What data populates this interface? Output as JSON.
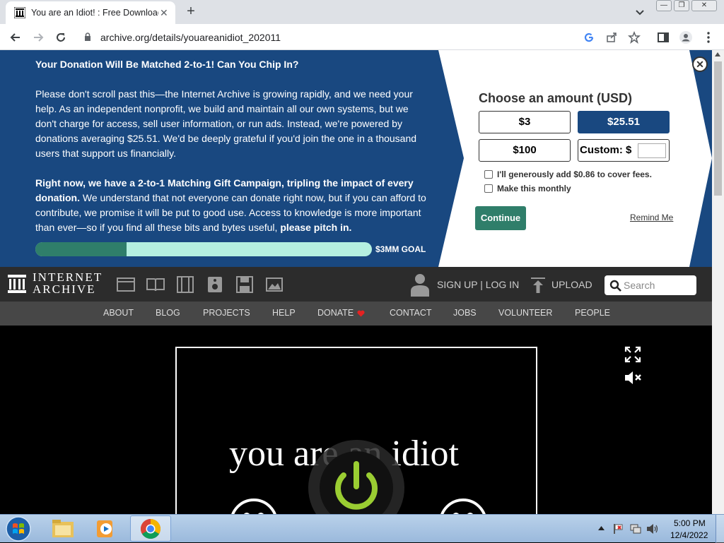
{
  "browser": {
    "tab_title": "You are an Idiot! : Free Download",
    "url": "archive.org/details/youareanidiot_202011",
    "new_tab": "+",
    "tab_close": "✕"
  },
  "banner": {
    "heading": "Your Donation Will Be Matched 2-to-1! Can You Chip In?",
    "para1": "Please don't scroll past this—the Internet Archive is growing rapidly, and we need your help. As an independent nonprofit, we build and maintain all our own systems, but we don't charge for access, sell user information, or run ads. Instead, we're powered by donations averaging $25.51. We'd be deeply grateful if you'd join the one in a thousand users that support us financially.",
    "para2_bold": "Right now, we have a 2-to-1 Matching Gift Campaign, tripling the impact of every donation.",
    "para2_rest": " We understand that not everyone can donate right now, but if you can afford to contribute, we promise it will be put to good use. Access to knowledge is more important than ever—so if you find all these bits and bytes useful, ",
    "para2_end": "please pitch in.",
    "progress_fraction": 0.27,
    "goal": "$3MM GOAL",
    "close": "✕",
    "choose": "Choose an amount (USD)",
    "amounts": [
      "$3",
      "$25.51",
      "$100"
    ],
    "custom_label": "Custom: $",
    "cover_fees": "I'll generously add $0.86 to cover fees.",
    "monthly": "Make this monthly",
    "continue": "Continue",
    "remind": "Remind Me"
  },
  "ia_nav": {
    "logo_line1": "INTERNET",
    "logo_line2": "ARCHIVE",
    "signup": "SIGN UP | LOG IN",
    "upload": "UPLOAD",
    "search_placeholder": "Search",
    "subnav": [
      "ABOUT",
      "BLOG",
      "PROJECTS",
      "HELP",
      "DONATE",
      "CONTACT",
      "JOBS",
      "VOLUNTEER",
      "PEOPLE"
    ]
  },
  "video": {
    "title": "you are an idiot"
  },
  "taskbar": {
    "time": "5:00 PM",
    "date": "12/4/2022"
  },
  "colors": {
    "banner_blue": "#194880",
    "continue_green": "#2f7e6a",
    "progress_light": "#b5f0e0"
  }
}
